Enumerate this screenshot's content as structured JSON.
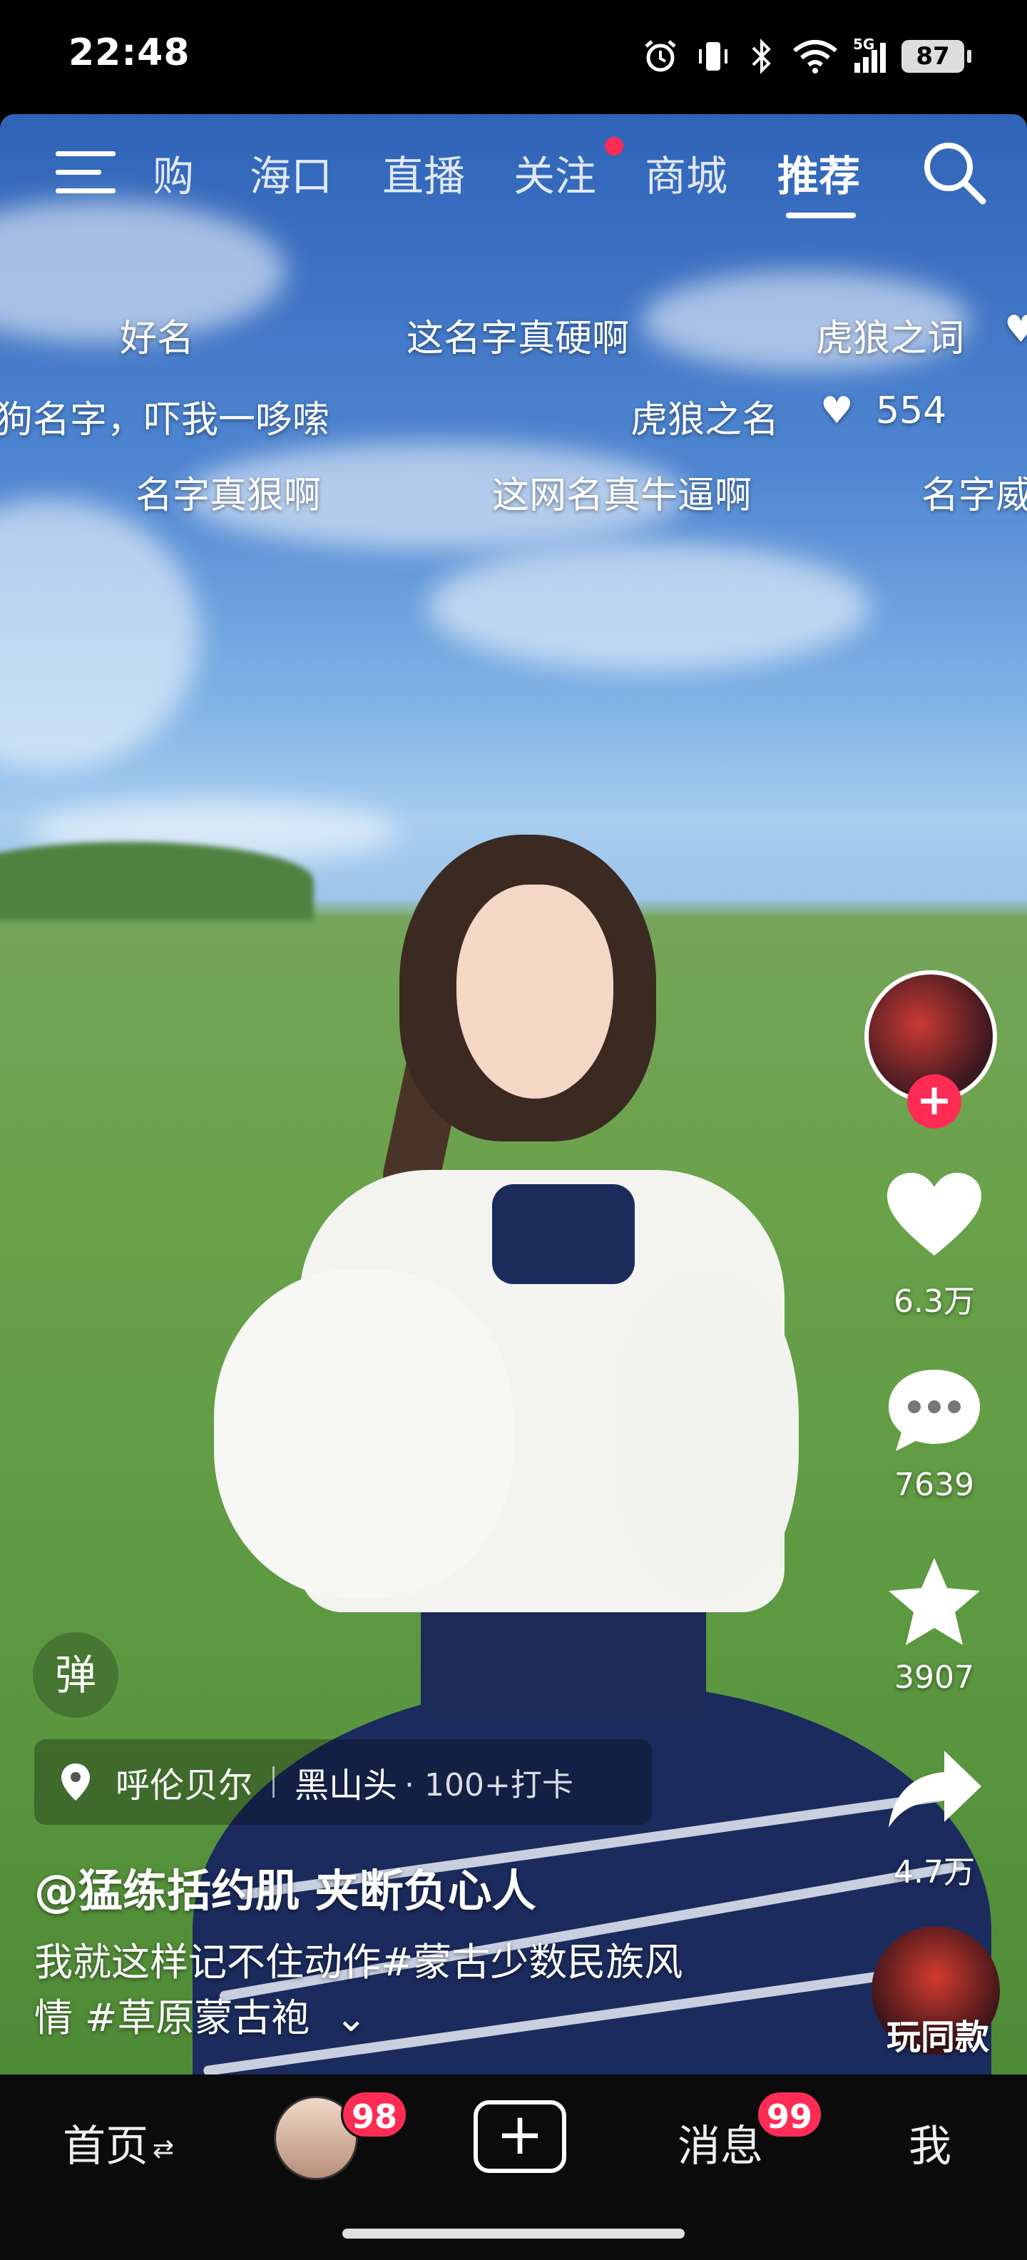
{
  "status_bar": {
    "time": "22:48",
    "network": "5G",
    "battery": "87"
  },
  "top_nav": {
    "tabs": [
      {
        "label": "购",
        "active": false
      },
      {
        "label": "海口",
        "active": false
      },
      {
        "label": "直播",
        "active": false
      },
      {
        "label": "关注",
        "active": false,
        "has_dot": true
      },
      {
        "label": "商城",
        "active": false
      },
      {
        "label": "推荐",
        "active": true
      }
    ],
    "icons": {
      "menu": "menu-icon",
      "search": "search-icon"
    }
  },
  "danmaku": [
    "好名",
    "这名字真硬啊",
    "虎狼之词",
    "狗名字，吓我一哆嗦",
    "虎狼之名",
    "554",
    "名字真狠啊",
    "这网名真牛逼啊",
    "名字威"
  ],
  "right_rail": {
    "like_count": "6.3万",
    "comment_count": "7639",
    "favorite_count": "3907",
    "share_count": "4.7万",
    "same_style_label": "玩同款"
  },
  "danmaku_toggle": "弹",
  "location": {
    "city": "呼伦贝尔",
    "place": "黑山头",
    "extra": "· 100+打卡"
  },
  "video_info": {
    "author": "@猛练括约肌 夹断负心人",
    "caption_line1": "我就这样记不住动作#蒙古少数民族风",
    "caption_line2": "情 #草原蒙古袍",
    "expand_icon": "⌄"
  },
  "bottom_nav": {
    "home": "首页",
    "home_switch_icon": "⇄",
    "friends_badge": "98",
    "create_icon": "+",
    "messages": "消息",
    "messages_badge": "99",
    "me": "我"
  },
  "colors": {
    "accent": "#fe2c55",
    "nav_bg": "#0b0b0b"
  }
}
